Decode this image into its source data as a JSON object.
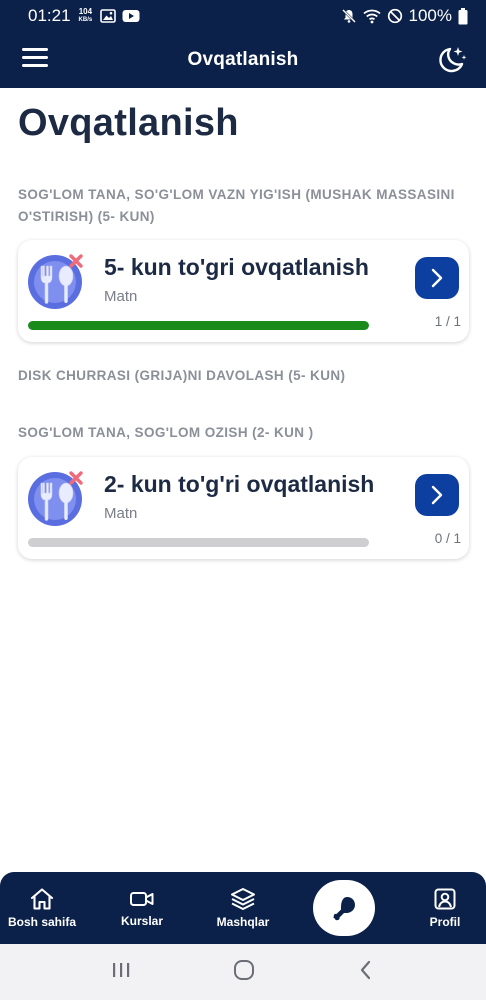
{
  "status": {
    "time": "01:21",
    "speed_value": "104",
    "speed_unit": "KB/s",
    "battery": "100%"
  },
  "appbar": {
    "title": "Ovqatlanish"
  },
  "page": {
    "title": "Ovqatlanish"
  },
  "sections": [
    {
      "label": "SOG'LOM TANA, SO'G'LOM VAZN YIG'ISH (MUSHAK MASSASINI O'STIRISH) (5- KUN)",
      "card": {
        "title": "5- kun to'gri ovqatlanish",
        "subtitle": "Matn",
        "count": "1 / 1",
        "progress": 1.0,
        "progress_color": "#1a8a1a"
      }
    },
    {
      "label": "DISK CHURRASI (GRIJA)NI DAVOLASH (5- KUN)"
    },
    {
      "label": "SOG'LOM TANA, SOG'LOM OZISH (2- KUN )",
      "card": {
        "title": "2- kun to'g'ri ovqatlanish",
        "subtitle": "Matn",
        "count": "0 / 1",
        "progress": 0.0,
        "progress_color": "#1a8a1a"
      }
    }
  ],
  "bottom_nav": {
    "items": [
      {
        "label": "Bosh sahifa",
        "icon": "home-icon"
      },
      {
        "label": "Kurslar",
        "icon": "video-icon"
      },
      {
        "label": "Mashqlar",
        "icon": "layers-icon"
      },
      {
        "label": "",
        "icon": "chicken-leg-icon"
      },
      {
        "label": "Profil",
        "icon": "profile-icon"
      }
    ]
  },
  "colors": {
    "primary_dark": "#0b2149",
    "accent_blue": "#0d3fa0",
    "progress_green": "#1a8a1a"
  }
}
